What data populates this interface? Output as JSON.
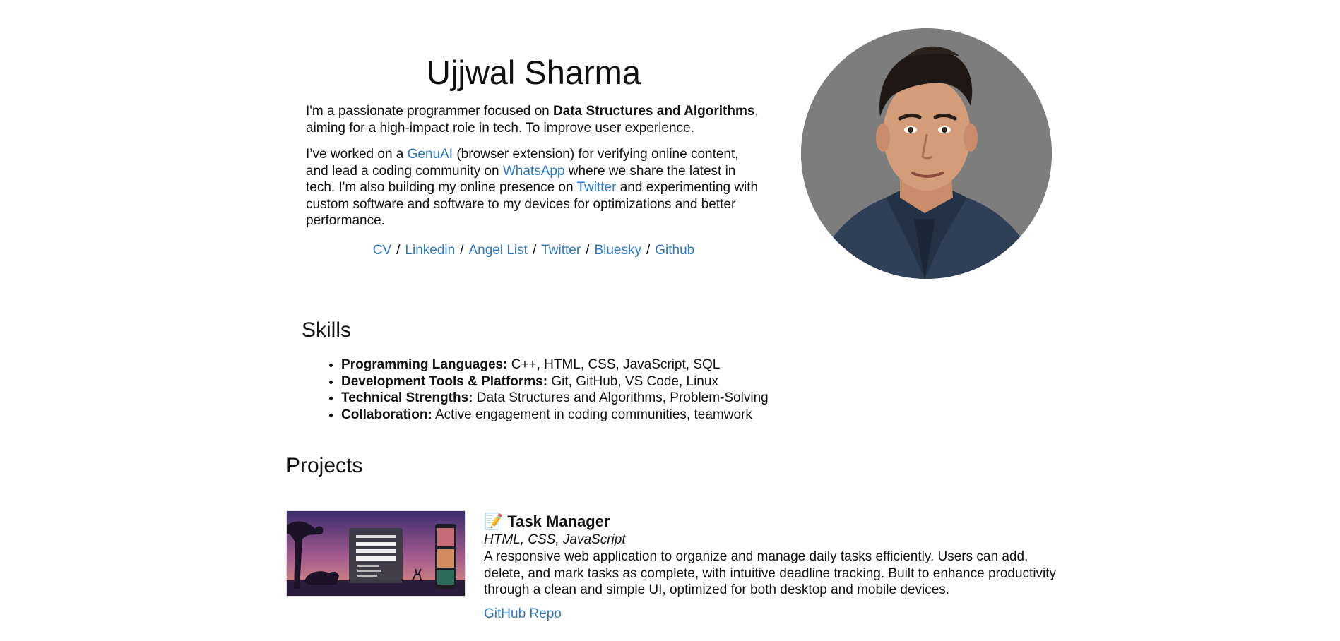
{
  "hero": {
    "name": "Ujjwal Sharma",
    "bio1": {
      "pre": "I'm a passionate programmer focused on ",
      "bold": "Data Structures and Algorithms",
      "post": ", aiming for a high-impact role in tech. To improve user experience."
    },
    "bio2": {
      "t1": "I’ve worked on a ",
      "link1": "GenuAI",
      "t2": " (browser extension) for verifying online content, and lead a coding community on ",
      "link2": "WhatsApp",
      "t3": " where we share the latest in tech. I'm also building my online presence on ",
      "link3": "Twitter",
      "t4": " and experimenting with custom software and software to my devices for optimizations and better performance."
    },
    "social": [
      "CV",
      "Linkedin",
      "Angel List",
      "Twitter",
      "Bluesky",
      "Github"
    ],
    "separator": "/"
  },
  "skills": {
    "title": "Skills",
    "items": [
      {
        "label": "Programming Languages:",
        "value": " C++, HTML, CSS, JavaScript, SQL"
      },
      {
        "label": "Development Tools & Platforms:",
        "value": " Git, GitHub, VS Code, Linux"
      },
      {
        "label": "Technical Strengths:",
        "value": " Data Structures and Algorithms, Problem-Solving"
      },
      {
        "label": "Collaboration:",
        "value": " Active engagement in coding communities, teamwork"
      }
    ]
  },
  "projects": {
    "title": "Projects",
    "items": [
      {
        "emoji": "📝",
        "name": "Task Manager",
        "tech": "HTML, CSS, JavaScript",
        "description": "A responsive web application to organize and manage daily tasks efficiently. Users can add, delete, and mark tasks as complete, with intuitive deadline tracking. Built to enhance productivity through a clean and simple UI, optimized for both desktop and mobile devices.",
        "link": "GitHub Repo"
      }
    ]
  },
  "colors": {
    "link": "#2a78c7",
    "text": "#111111",
    "avatar_bg": "#7d7d7d"
  }
}
